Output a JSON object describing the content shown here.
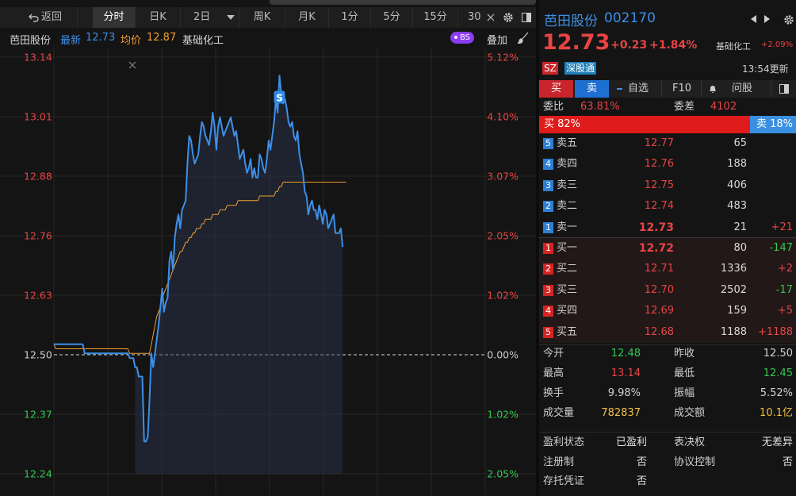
{
  "toolbar": {
    "back_label": "返回",
    "tabs": [
      "分时",
      "日K",
      "2日",
      "周K",
      "月K",
      "1分",
      "5分",
      "15分",
      "30"
    ]
  },
  "infobar": {
    "name": "芭田股份",
    "latest_label": "最新",
    "latest_value": "12.73",
    "avg_label": "均价",
    "avg_value": "12.87",
    "sector": "基础化工",
    "bs_badge": "BS",
    "overlay_label": "叠加"
  },
  "chart_data": {
    "type": "line",
    "prev_close": 12.5,
    "ylim": [
      12.24,
      13.14
    ],
    "left_ticks": [
      "13.14",
      "13.01",
      "12.88",
      "12.76",
      "12.63",
      "12.50",
      "12.37",
      "12.24"
    ],
    "right_ticks": [
      "5.12%",
      "4.10%",
      "3.07%",
      "2.05%",
      "1.02%",
      "0.00%",
      "1.02%",
      "2.05%"
    ],
    "total_points": 240,
    "signal_label": "S",
    "signal_index": 125,
    "series": [
      {
        "values": [
          12.52,
          12.52,
          12.52,
          12.52,
          12.52,
          12.52,
          12.52,
          12.52,
          12.52,
          12.52,
          12.52,
          12.52,
          12.52,
          12.52,
          12.52,
          12.52,
          12.52,
          12.5,
          12.5,
          12.5,
          12.5,
          12.5,
          12.5,
          12.5,
          12.5,
          12.5,
          12.5,
          12.5,
          12.5,
          12.5,
          12.5,
          12.5,
          12.5,
          12.5,
          12.5,
          12.5,
          12.5,
          12.5,
          12.5,
          12.5,
          12.5,
          12.5,
          12.49,
          12.49,
          12.49,
          12.47,
          12.47,
          12.45,
          12.45,
          12.45,
          12.31,
          12.31,
          12.32,
          12.4,
          12.5,
          12.47,
          12.5,
          12.53,
          12.56,
          12.6,
          12.64,
          12.59,
          12.61,
          12.62,
          12.7,
          12.72,
          12.68,
          12.75,
          12.78,
          12.8,
          12.77,
          12.81,
          12.82,
          12.83,
          12.91,
          12.97,
          12.96,
          12.93,
          12.91,
          12.92,
          12.93,
          12.97,
          13.0,
          12.99,
          12.97,
          12.96,
          12.95,
          12.98,
          13.02,
          12.99,
          12.94,
          12.99,
          13.01,
          12.99,
          12.97,
          12.98,
          12.99,
          13.0,
          13.01,
          12.99,
          12.97,
          12.98,
          12.95,
          12.92,
          12.93,
          12.94,
          12.91,
          12.89,
          12.9,
          12.92,
          12.88,
          12.9,
          12.88,
          12.88,
          12.93,
          12.92,
          12.9,
          12.89,
          12.92,
          12.96,
          12.94,
          12.97,
          13.0,
          13.05,
          13.02,
          13.1,
          13.06,
          13.04,
          13.05,
          13.03,
          13.0,
          12.99,
          13.0,
          12.97,
          12.96,
          12.98,
          12.93,
          12.91,
          12.89,
          12.85,
          12.84,
          12.8,
          12.82,
          12.83,
          12.81,
          12.81,
          12.79,
          12.82,
          12.8,
          12.78,
          12.81,
          12.8,
          12.77,
          12.78,
          12.79,
          12.8,
          12.76,
          12.76,
          12.76,
          12.77,
          12.73
        ],
        "color": "#3d8fe8",
        "width": 2
      },
      {
        "values": [
          12.52,
          12.51,
          12.51,
          12.51,
          12.51,
          12.51,
          12.51,
          12.51,
          12.51,
          12.51,
          12.51,
          12.51,
          12.51,
          12.51,
          12.51,
          12.51,
          12.51,
          12.51,
          12.51,
          12.51,
          12.51,
          12.51,
          12.51,
          12.51,
          12.51,
          12.51,
          12.51,
          12.51,
          12.51,
          12.51,
          12.51,
          12.51,
          12.51,
          12.51,
          12.51,
          12.51,
          12.51,
          12.51,
          12.51,
          12.51,
          12.51,
          12.51,
          12.5,
          12.5,
          12.5,
          12.5,
          12.5,
          12.5,
          12.5,
          12.5,
          12.5,
          12.5,
          12.5,
          12.5,
          12.52,
          12.54,
          12.56,
          12.58,
          12.59,
          12.6,
          12.62,
          12.63,
          12.64,
          12.65,
          12.66,
          12.67,
          12.68,
          12.69,
          12.7,
          12.71,
          12.72,
          12.72,
          12.73,
          12.74,
          12.74,
          12.75,
          12.75,
          12.76,
          12.76,
          12.77,
          12.77,
          12.77,
          12.78,
          12.78,
          12.79,
          12.79,
          12.79,
          12.79,
          12.8,
          12.8,
          12.8,
          12.8,
          12.81,
          12.81,
          12.81,
          12.81,
          12.82,
          12.82,
          12.82,
          12.82,
          12.82,
          12.82,
          12.83,
          12.83,
          12.83,
          12.83,
          12.83,
          12.83,
          12.83,
          12.83,
          12.83,
          12.83,
          12.83,
          12.83,
          12.84,
          12.84,
          12.84,
          12.84,
          12.84,
          12.84,
          12.84,
          12.84,
          12.84,
          12.85,
          12.85,
          12.86,
          12.86,
          12.87,
          12.87,
          12.87,
          12.87,
          12.87,
          12.87,
          12.87,
          12.87,
          12.87,
          12.87,
          12.87,
          12.87,
          12.87,
          12.87,
          12.87,
          12.87,
          12.87,
          12.87,
          12.87,
          12.87,
          12.87,
          12.87,
          12.87,
          12.87,
          12.87,
          12.87,
          12.87,
          12.87,
          12.87,
          12.87,
          12.87,
          12.87,
          12.87,
          12.87,
          12.87,
          12.87
        ],
        "color": "#f0a030",
        "width": 1
      }
    ]
  },
  "header": {
    "title": "芭田股份",
    "code": "002170",
    "price": "12.73",
    "change": "+0.23",
    "change_pct": "+1.84%",
    "sector_name": "基础化工",
    "sector_pct": "+2.09%",
    "market_badge": "SZ",
    "connect_badge": "深股通",
    "update_time": "13:54更新"
  },
  "actions": {
    "buy": "买",
    "sell": "卖",
    "watch": "自选",
    "f10": "F10",
    "ask": "问股"
  },
  "ratio": {
    "wb_label": "委比",
    "wb_value": "63.81%",
    "wc_label": "委差",
    "wc_value": "4102",
    "buy_pct": "买 82%",
    "sell_pct": "卖 18%",
    "buy_fraction": 0.82
  },
  "asks": [
    {
      "idx": "5",
      "label": "卖五",
      "price": "12.77",
      "vol": "65",
      "chg": ""
    },
    {
      "idx": "4",
      "label": "卖四",
      "price": "12.76",
      "vol": "188",
      "chg": ""
    },
    {
      "idx": "3",
      "label": "卖三",
      "price": "12.75",
      "vol": "406",
      "chg": ""
    },
    {
      "idx": "2",
      "label": "卖二",
      "price": "12.74",
      "vol": "483",
      "chg": ""
    },
    {
      "idx": "1",
      "label": "卖一",
      "price": "12.73",
      "vol": "21",
      "chg": "+21"
    }
  ],
  "bids": [
    {
      "idx": "1",
      "label": "买一",
      "price": "12.72",
      "vol": "80",
      "chg": "-147"
    },
    {
      "idx": "2",
      "label": "买二",
      "price": "12.71",
      "vol": "1336",
      "chg": "+2"
    },
    {
      "idx": "3",
      "label": "买三",
      "price": "12.70",
      "vol": "2502",
      "chg": "-17"
    },
    {
      "idx": "4",
      "label": "买四",
      "price": "12.69",
      "vol": "159",
      "chg": "+5"
    },
    {
      "idx": "5",
      "label": "买五",
      "price": "12.68",
      "vol": "1188",
      "chg": "+1188"
    }
  ],
  "stats": [
    {
      "l1": "今开",
      "v1": "12.48",
      "c1": "green",
      "l2": "昨收",
      "v2": "12.50",
      "c2": "grey"
    },
    {
      "l1": "最高",
      "v1": "13.14",
      "c1": "red",
      "l2": "最低",
      "v2": "12.45",
      "c2": "green"
    },
    {
      "l1": "换手",
      "v1": "9.98%",
      "c1": "grey",
      "l2": "振幅",
      "v2": "5.52%",
      "c2": "grey"
    },
    {
      "l1": "成交量",
      "v1": "782837",
      "c1": "yellow",
      "l2": "成交额",
      "v2": "10.1亿",
      "c2": "yellow"
    }
  ],
  "status": [
    {
      "l1": "盈利状态",
      "v1": "已盈利",
      "l2": "表决权",
      "v2": "无差异"
    },
    {
      "l1": "注册制",
      "v1": "否",
      "l2": "协议控制",
      "v2": "否"
    },
    {
      "l1": "存托凭证",
      "v1": "否",
      "l2": "",
      "v2": ""
    }
  ]
}
